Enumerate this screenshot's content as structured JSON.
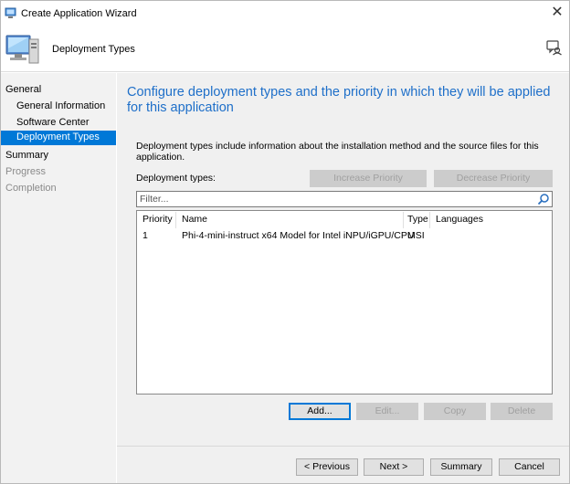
{
  "window": {
    "title": "Create Application Wizard",
    "close_icon": "close-icon"
  },
  "header": {
    "title": "Deployment Types",
    "icon": "computer-wizard-icon",
    "help_icon": "help-icon"
  },
  "nav": {
    "items": [
      {
        "label": "General",
        "state": "normal"
      },
      {
        "label": "General Information",
        "state": "normal"
      },
      {
        "label": "Software Center",
        "state": "normal"
      },
      {
        "label": "Deployment Types",
        "state": "selected"
      },
      {
        "label": "Summary",
        "state": "normal"
      },
      {
        "label": "Progress",
        "state": "disabled"
      },
      {
        "label": "Completion",
        "state": "disabled"
      }
    ]
  },
  "main": {
    "title": "Configure deployment types and the priority in which they will be applied for this application",
    "description": "Deployment types include information about the installation method and the source files for this application.",
    "deployment_types_label": "Deployment types:",
    "increase_priority": "Increase Priority",
    "decrease_priority": "Decrease Priority",
    "filter_placeholder": "Filter...",
    "columns": [
      "Priority",
      "Name",
      "Type",
      "Languages"
    ],
    "rows": [
      {
        "priority": "1",
        "name": "Phi-4-mini-instruct x64 Model for Intel iNPU/iGPU/CPU",
        "type": "MSI",
        "languages": ""
      }
    ],
    "add": "Add...",
    "edit": "Edit...",
    "copy": "Copy",
    "delete": "Delete"
  },
  "footer": {
    "previous": "< Previous",
    "next": "Next >",
    "summary": "Summary",
    "cancel": "Cancel"
  },
  "colors": {
    "accent": "#0078d7",
    "title_blue": "#1e6fc9",
    "disabled_text": "#8a8a8a"
  }
}
